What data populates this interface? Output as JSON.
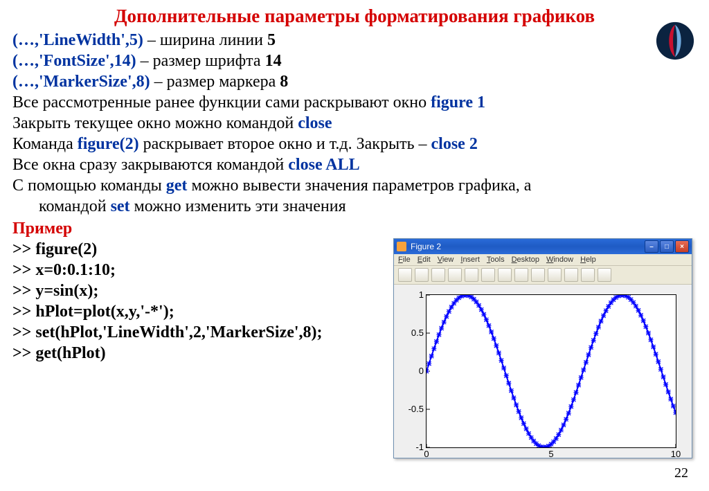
{
  "title": "Дополнительные параметры форматирования графиков",
  "params": {
    "linewidth_code": "(…,'LineWidth',5)",
    "linewidth_desc": " – ширина линии   ",
    "linewidth_val": "5",
    "fontsize_code": "(…,'FontSize',14)",
    "fontsize_desc": " – размер шрифта ",
    "fontsize_val": "14",
    "markersize_code": "(…,'MarkerSize',8)",
    "markersize_desc": " – размер маркера ",
    "markersize_val": "8"
  },
  "body": {
    "l1a": "Все рассмотренные ранее функции сами раскрывают окно ",
    "l1b": "figure 1",
    "l2a": "Закрыть текущее окно можно командой  ",
    "l2b": "close",
    "l3a": "Команда ",
    "l3b": "figure(2)",
    "l3c": " раскрывает второе окно и т.д. Закрыть – ",
    "l3d": "close 2",
    "l4a": "Все окна сразу закрываются командой ",
    "l4b": "close ALL",
    "l5a": "С помощью команды ",
    "l5b": "get",
    "l5c": " можно вывести значения параметров графика, а",
    "l5d": "командой ",
    "l5e": "set",
    "l5f": " можно изменить эти значения"
  },
  "example": {
    "title": "Пример",
    "lines": [
      ">> figure(2)",
      ">> x=0:0.1:10;",
      ">> y=sin(x);",
      ">> hPlot=plot(x,y,'-*');",
      ">> set(hPlot,'LineWidth',2,'MarkerSize',8);",
      ">> get(hPlot)"
    ]
  },
  "figure_window": {
    "title": "Figure 2",
    "menus": [
      "File",
      "Edit",
      "View",
      "Insert",
      "Tools",
      "Desktop",
      "Window",
      "Help"
    ],
    "toolbar_count": 13
  },
  "chart_data": {
    "type": "line",
    "title": "",
    "xlabel": "",
    "ylabel": "",
    "xlim": [
      0,
      10
    ],
    "ylim": [
      -1,
      1
    ],
    "xticks": [
      0,
      5,
      10
    ],
    "yticks": [
      -1,
      -0.5,
      0,
      0.5,
      1
    ],
    "x_step": 0.1,
    "series": [
      {
        "name": "sin(x)",
        "marker": "*",
        "line": "-",
        "color": "#0000ff",
        "linewidth": 2,
        "markersize": 8,
        "x": [
          0,
          0.1,
          0.2,
          0.3,
          0.4,
          0.5,
          0.6,
          0.7,
          0.8,
          0.9,
          1,
          1.1,
          1.2,
          1.3,
          1.4,
          1.5,
          1.6,
          1.7,
          1.8,
          1.9,
          2,
          2.1,
          2.2,
          2.3,
          2.4,
          2.5,
          2.6,
          2.7,
          2.8,
          2.9,
          3,
          3.1,
          3.2,
          3.3,
          3.4,
          3.5,
          3.6,
          3.7,
          3.8,
          3.9,
          4,
          4.1,
          4.2,
          4.3,
          4.4,
          4.5,
          4.6,
          4.7,
          4.8,
          4.9,
          5,
          5.1,
          5.2,
          5.3,
          5.4,
          5.5,
          5.6,
          5.7,
          5.8,
          5.9,
          6,
          6.1,
          6.2,
          6.3,
          6.4,
          6.5,
          6.6,
          6.7,
          6.8,
          6.9,
          7,
          7.1,
          7.2,
          7.3,
          7.4,
          7.5,
          7.6,
          7.7,
          7.8,
          7.9,
          8,
          8.1,
          8.2,
          8.3,
          8.4,
          8.5,
          8.6,
          8.7,
          8.8,
          8.9,
          9,
          9.1,
          9.2,
          9.3,
          9.4,
          9.5,
          9.6,
          9.7,
          9.8,
          9.9,
          10
        ],
        "y": [
          0,
          0.0998,
          0.1987,
          0.2955,
          0.3894,
          0.4794,
          0.5646,
          0.6442,
          0.7174,
          0.7833,
          0.8415,
          0.8912,
          0.932,
          0.9636,
          0.9854,
          0.9975,
          0.9996,
          0.9917,
          0.9738,
          0.9463,
          0.9093,
          0.8632,
          0.8085,
          0.7457,
          0.6755,
          0.5985,
          0.5155,
          0.4274,
          0.335,
          0.2392,
          0.1411,
          0.0416,
          -0.0584,
          -0.1577,
          -0.2555,
          -0.3508,
          -0.4425,
          -0.5298,
          -0.6119,
          -0.6878,
          -0.7568,
          -0.8183,
          -0.8716,
          -0.9162,
          -0.9516,
          -0.9775,
          -0.9937,
          -0.9999,
          -0.9962,
          -0.9825,
          -0.9589,
          -0.9258,
          -0.8835,
          -0.8323,
          -0.7728,
          -0.7055,
          -0.6313,
          -0.5507,
          -0.4646,
          -0.3739,
          -0.2794,
          -0.1822,
          -0.0831,
          0.0168,
          0.1165,
          0.215,
          0.3115,
          0.4048,
          0.4941,
          0.5784,
          0.657,
          0.729,
          0.7937,
          0.8504,
          0.8987,
          0.938,
          0.9679,
          0.9882,
          0.9985,
          0.9989,
          0.9894,
          0.9699,
          0.9407,
          0.9022,
          0.8546,
          0.7985,
          0.7344,
          0.663,
          0.5849,
          0.501,
          0.4121,
          0.3191,
          0.2229,
          0.1245,
          0.0248,
          -0.0752,
          -0.1743,
          -0.2718,
          -0.3665,
          -0.4575,
          -0.544
        ]
      }
    ]
  },
  "page_number": "22"
}
